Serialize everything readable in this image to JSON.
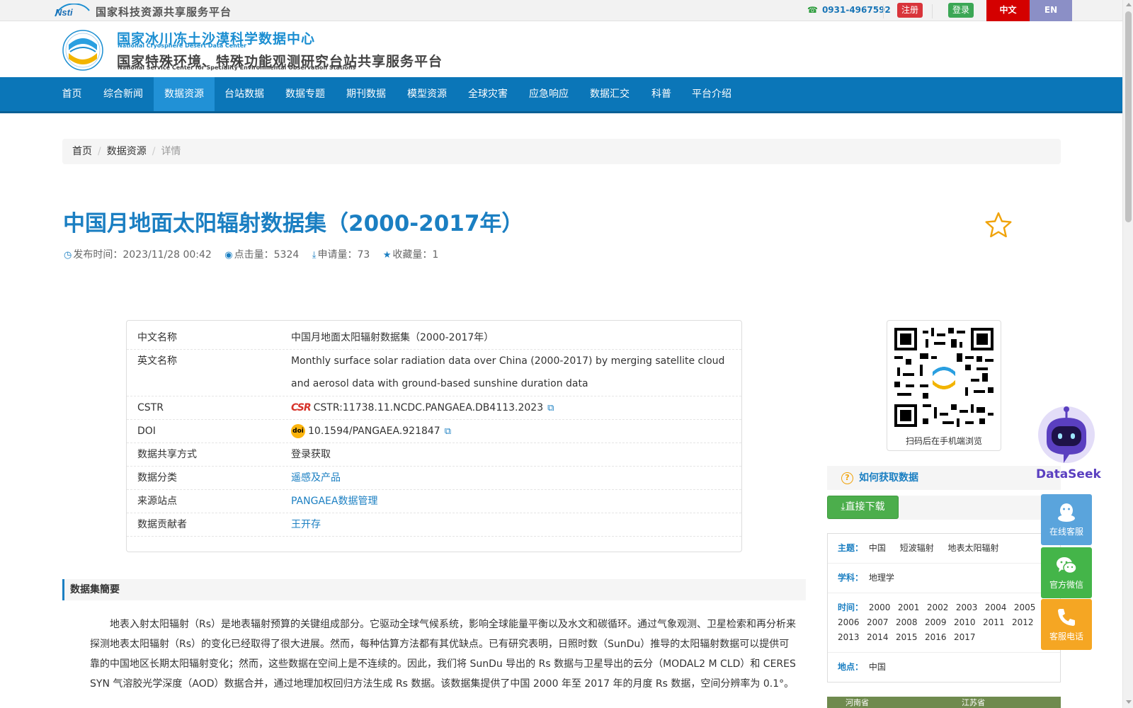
{
  "topbar": {
    "platform_name": "国家科技资源共享服务平台",
    "logo_text": "Nsti",
    "phone": "0931-4967592",
    "register": "注册",
    "login": "登录",
    "lang_zh": "中文",
    "lang_en": "EN"
  },
  "header": {
    "title_cn": "国家冰川冻土沙漠科学数据中心",
    "title_en": "National Cryosphere Desert Data Center",
    "subtitle_cn": "国家特殊环境、特殊功能观测研究台站共享服务平台",
    "subtitle_en": "National Service Center for Speciality Environmental Observation Stations"
  },
  "nav": {
    "items": [
      {
        "label": "首页"
      },
      {
        "label": "综合新闻"
      },
      {
        "label": "数据资源"
      },
      {
        "label": "台站数据"
      },
      {
        "label": "数据专题"
      },
      {
        "label": "期刊数据"
      },
      {
        "label": "模型资源"
      },
      {
        "label": "全球灾害"
      },
      {
        "label": "应急响应"
      },
      {
        "label": "数据汇交"
      },
      {
        "label": "科普"
      },
      {
        "label": "平台介绍"
      }
    ],
    "active": "数据资源"
  },
  "breadcrumb": {
    "home": "首页",
    "section": "数据资源",
    "current": "详情"
  },
  "dataset": {
    "title": "中国月地面太阳辐射数据集（2000-2017年）",
    "meta": {
      "publish_label": "发布时间：",
      "publish_time": "2023/11/28 00:42",
      "clicks_label": "点击量：",
      "clicks": "5324",
      "applies_label": "申请量：",
      "applies": "73",
      "favs_label": "收藏量：",
      "favs": "1"
    },
    "info": {
      "cn_name_label": "中文名称",
      "cn_name": "中国月地面太阳辐射数据集（2000-2017年）",
      "en_name_label": "英文名称",
      "en_name": "Monthly surface solar radiation data over China (2000-2017) by merging satellite cloud and aerosol data with ground-based sunshine duration data",
      "cstr_label": "CSTR",
      "cstr_logo": "CSR",
      "cstr": "CSTR:11738.11.NCDC.PANGAEA.DB4113.2023",
      "doi_label": "DOI",
      "doi_logo": "doi",
      "doi": "10.1594/PANGAEA.921847",
      "share_label": "数据共享方式",
      "share": "登录获取",
      "category_label": "数据分类",
      "category": "遥感及产品",
      "station_label": "来源站点",
      "station": "PANGAEA数据管理",
      "contributor_label": "数据贡献者",
      "contributor": "王开存"
    },
    "abstract_title": "数据集簡要",
    "abstract": "地表入射太阳辐射（Rs）是地表辐射预算的关键组成部分。它驱动全球气候系统，影响全球能量平衡以及水文和碳循环。通过气象观测、卫星检索和再分析来探测地表太阳辐射（Rs）的变化已经取得了很大进展。然而，每种估算方法都有其优缺点。已有研究表明，日照时数（SunDu）推导的太阳辐射数据可以提供可靠的中国地区长期太阳辐射变化；然而，这些数据在空间上是不连续的。因此，我们将 SunDu 导出的 Rs 数据与卫星导出的云分（MODAL2 M CLD）和 CERES SYN 气溶胶光学深度（AOD）数据合并，通过地理加权回归方法生成 Rs 数据。该数据集提供了中国 2000 年至 2017 年的月度 Rs 数据，空间分辨率为 0.1°。"
  },
  "sidebar": {
    "qr_caption": "扫码后在手机端浏览",
    "how_title": "如何获取数据",
    "download": "直接下载",
    "subject_label": "主题：",
    "subjects": [
      "中国",
      "短波辐射",
      "地表太阳辐射"
    ],
    "discipline_label": "学科：",
    "discipline": "地理学",
    "time_label": "时间：",
    "years": [
      "2000",
      "2001",
      "2002",
      "2003",
      "2004",
      "2005",
      "2006",
      "2007",
      "2008",
      "2009",
      "2010",
      "2011",
      "2012",
      "2013",
      "2014",
      "2015",
      "2016",
      "2017"
    ],
    "place_label": "地点：",
    "place": "中国",
    "map_labels": [
      "河南省",
      "江苏省"
    ]
  },
  "float": {
    "dataseek": "DataSeek",
    "qq": "在线客服",
    "wechat": "官方微信",
    "phone": "客服电话"
  },
  "colors": {
    "primary": "#0b76b8",
    "link": "#1b7fc2",
    "register": "#d9343a",
    "login": "#3ba755",
    "lang_zh": "#d40000",
    "lang_en": "#8b8fc6",
    "download": "#4cae4c",
    "favorite_star": "#f0a30a"
  },
  "icons": [
    "phone-icon",
    "clock-icon",
    "eye-icon",
    "download-icon",
    "star-icon",
    "external-link-icon",
    "question-icon",
    "qq-icon",
    "wechat-icon",
    "phone-call-icon"
  ]
}
